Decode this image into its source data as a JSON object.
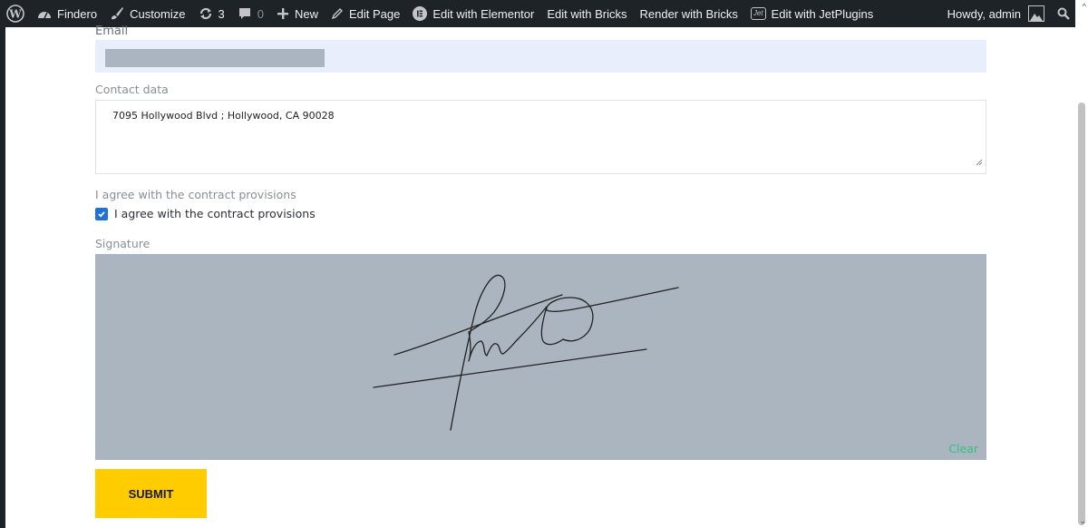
{
  "adminbar": {
    "site_name": "Findero",
    "customize": "Customize",
    "updates_count": "3",
    "comments_count": "0",
    "new": "New",
    "edit_page": "Edit Page",
    "edit_elementor": "Edit with Elementor",
    "edit_bricks": "Edit with Bricks",
    "render_bricks": "Render with Bricks",
    "jet_badge": "Jet",
    "edit_jetplugins": "Edit with JetPlugins",
    "howdy": "Howdy, admin",
    "icons": [
      "wordpress-icon",
      "dashboard-icon",
      "brush-icon",
      "updates-icon",
      "comment-icon",
      "plus-icon",
      "pencil-icon",
      "elementor-icon",
      "jet-icon",
      "avatar",
      "search-icon"
    ]
  },
  "form": {
    "email_label": "Email",
    "contact_label": "Contact data",
    "contact_value": "7095 Hollywood Blvd ; Hollywood, CA 90028",
    "agree_label": "I agree with the contract provisions",
    "agree_checkbox_label": "I agree with the contract provisions",
    "agree_checked": true,
    "signature_label": "Signature",
    "clear_label": "Clear",
    "submit_label": "SUBMIT"
  },
  "colors": {
    "adminbar_bg": "#1d2327",
    "email_bg": "#e8eefb",
    "signature_bg": "#aab5c0",
    "checkbox_blue": "#1e73d8",
    "clear_green": "#2ec27e",
    "submit_yellow": "#ffcc00"
  }
}
